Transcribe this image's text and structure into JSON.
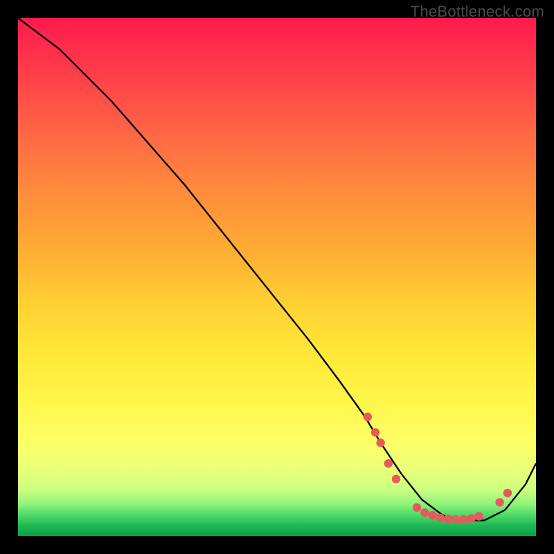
{
  "watermark": "TheBottleneck.com",
  "colors": {
    "bg": "#000000",
    "curve": "#000000",
    "marker": "#e55a5a"
  },
  "chart_data": {
    "type": "line",
    "title": "",
    "xlabel": "",
    "ylabel": "",
    "xlim": [
      0,
      100
    ],
    "ylim": [
      0,
      100
    ],
    "series": [
      {
        "name": "curve",
        "x": [
          0,
          4,
          8,
          12,
          18,
          25,
          32,
          40,
          48,
          56,
          62,
          67,
          70,
          74,
          78,
          82,
          86,
          90,
          94,
          98,
          100
        ],
        "y": [
          100,
          97,
          94,
          90,
          84,
          76,
          68,
          58,
          48,
          38,
          30,
          23,
          18,
          12,
          7,
          4,
          3,
          3,
          5,
          10,
          14
        ]
      }
    ],
    "markers": [
      {
        "x": 67.5,
        "y": 23
      },
      {
        "x": 69.0,
        "y": 20
      },
      {
        "x": 70.0,
        "y": 18
      },
      {
        "x": 71.5,
        "y": 14
      },
      {
        "x": 73.0,
        "y": 11
      },
      {
        "x": 77.0,
        "y": 5.5
      },
      {
        "x": 78.5,
        "y": 4.5
      },
      {
        "x": 80.0,
        "y": 4.0
      },
      {
        "x": 81.5,
        "y": 3.5
      },
      {
        "x": 83.0,
        "y": 3.3
      },
      {
        "x": 84.5,
        "y": 3.2
      },
      {
        "x": 86.0,
        "y": 3.2
      },
      {
        "x": 87.5,
        "y": 3.4
      },
      {
        "x": 89.0,
        "y": 3.8
      },
      {
        "x": 93.0,
        "y": 6.5
      },
      {
        "x": 94.5,
        "y": 8.3
      }
    ]
  }
}
